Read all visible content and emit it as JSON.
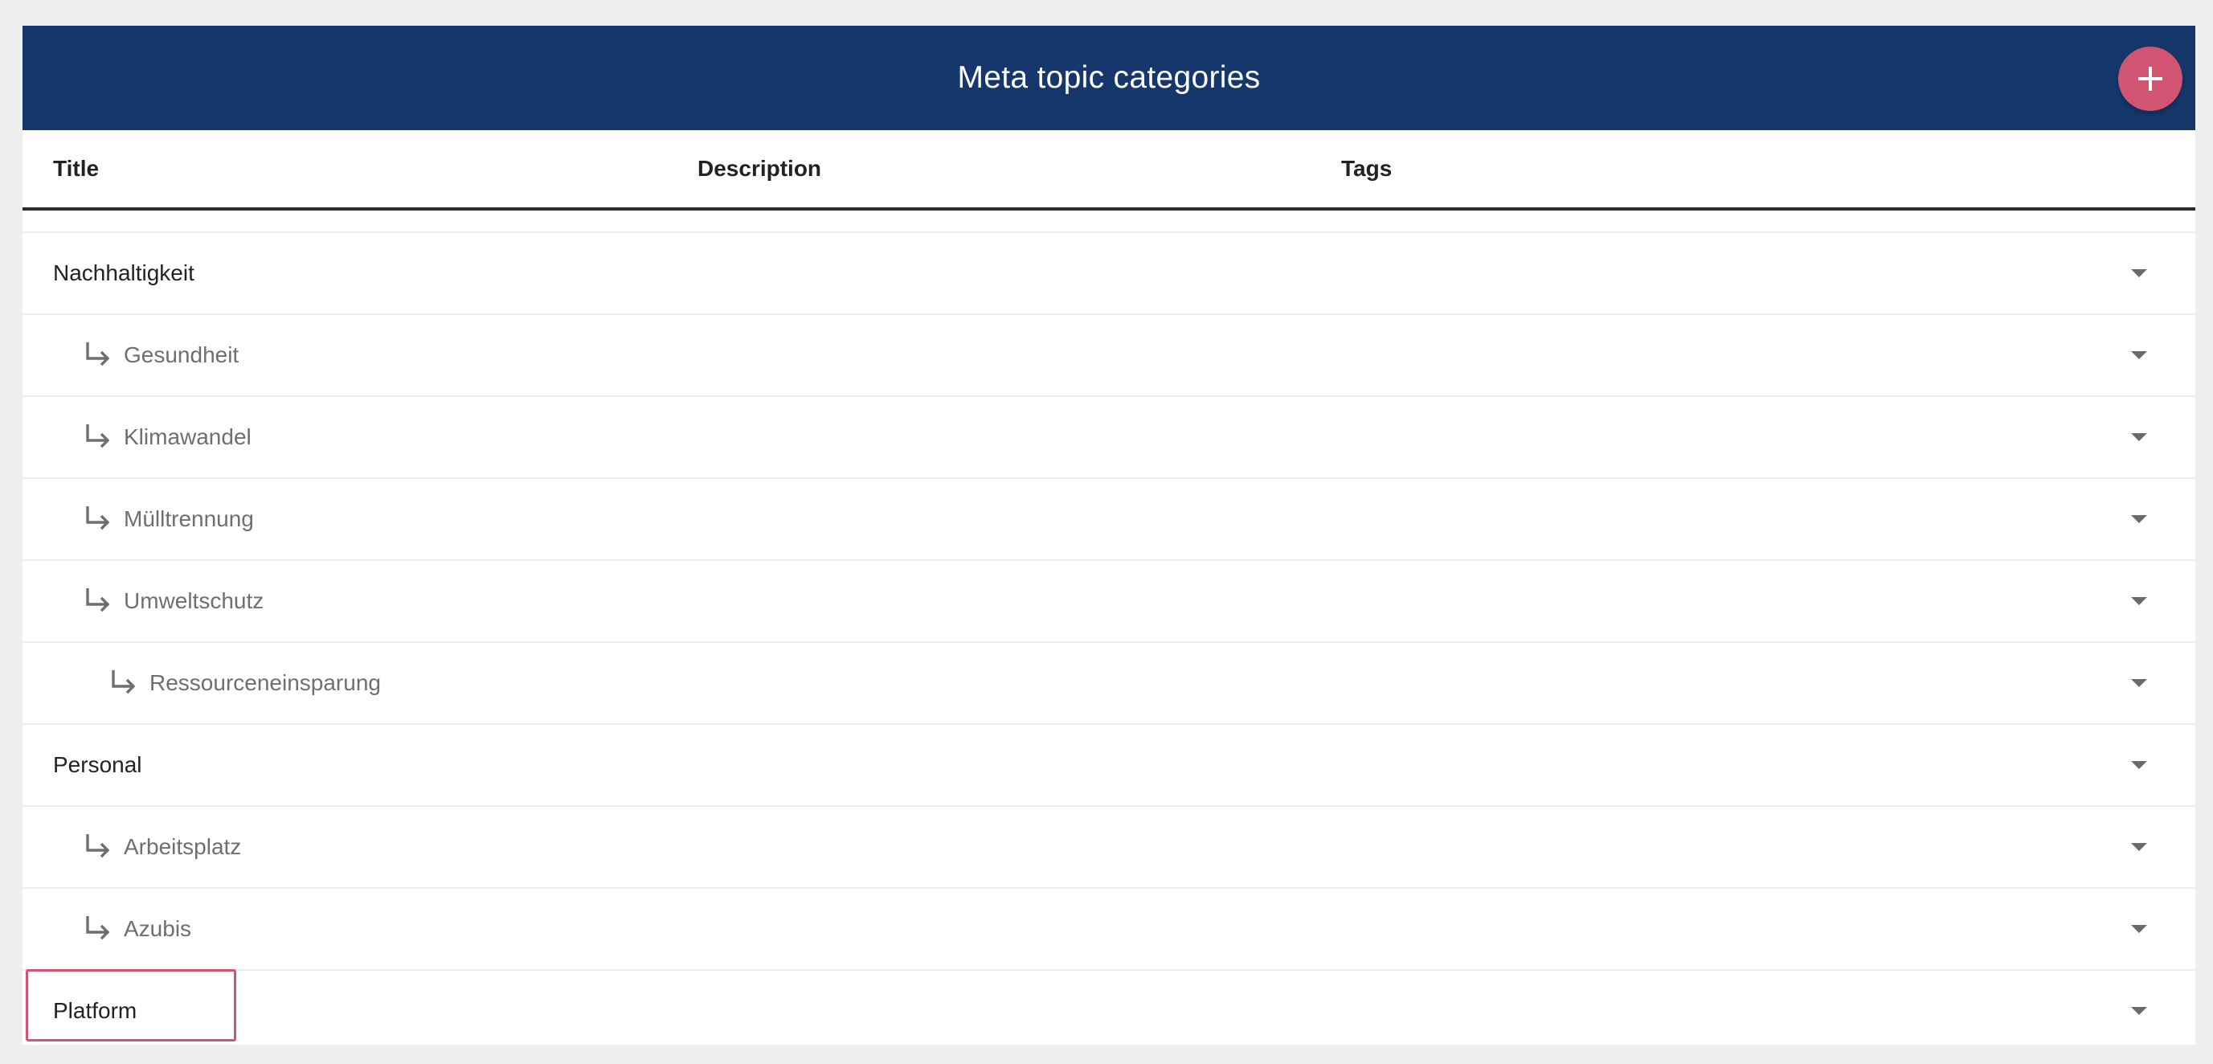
{
  "header": {
    "title": "Meta topic categories",
    "add_button_icon": "plus-icon"
  },
  "columns": {
    "title": "Title",
    "description": "Description",
    "tags": "Tags"
  },
  "rows": [
    {
      "label": "Nachhaltigkeit",
      "level": 0
    },
    {
      "label": "Gesundheit",
      "level": 1
    },
    {
      "label": "Klimawandel",
      "level": 1
    },
    {
      "label": "Mülltrennung",
      "level": 1
    },
    {
      "label": "Umweltschutz",
      "level": 1
    },
    {
      "label": "Ressourceneinsparung",
      "level": 2
    },
    {
      "label": "Personal",
      "level": 0
    },
    {
      "label": "Arbeitsplatz",
      "level": 1
    },
    {
      "label": "Azubis",
      "level": 1
    },
    {
      "label": "Platform",
      "level": 0
    }
  ],
  "colors": {
    "header_bg": "#15376b",
    "accent": "#d15573",
    "page_bg": "#efefef"
  }
}
